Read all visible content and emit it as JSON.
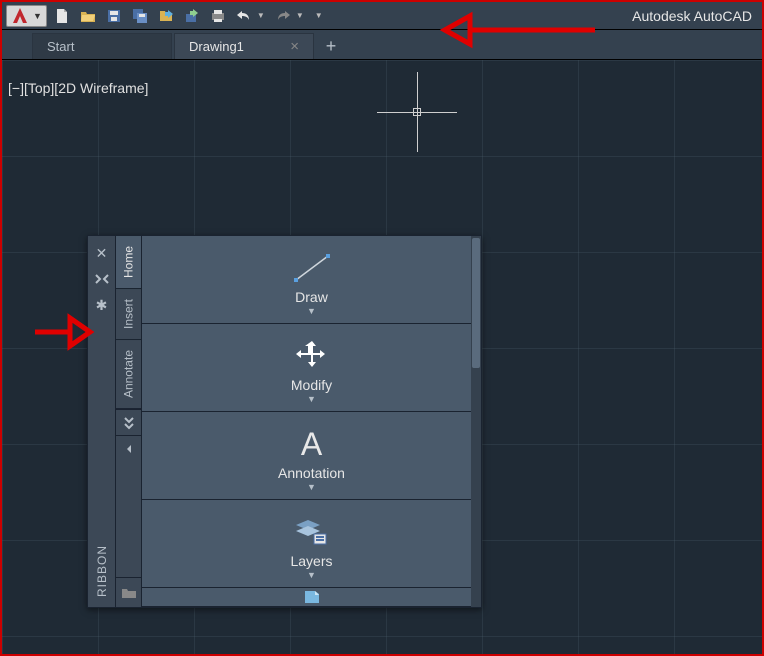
{
  "app": {
    "title": "Autodesk AutoCAD"
  },
  "qat": {
    "buttons": {
      "new": "new-file-icon",
      "open": "open-folder-icon",
      "save": "save-icon",
      "saveall": "save-all-icon",
      "web": "open-web-icon",
      "cloud": "save-cloud-icon",
      "plot": "plot-icon",
      "undo": "undo-icon",
      "redo": "redo-icon"
    }
  },
  "tabs": {
    "items": [
      {
        "label": "Start",
        "active": false,
        "closable": false
      },
      {
        "label": "Drawing1",
        "active": true,
        "closable": true
      }
    ],
    "add": "+"
  },
  "view": {
    "status": "[−][Top][2D Wireframe]"
  },
  "palette": {
    "title": "RIBBON",
    "side_buttons": {
      "close": "✕",
      "dock": "⇥",
      "settings": "✱"
    },
    "vtabs": [
      {
        "label": "Home",
        "active": true
      },
      {
        "label": "Insert",
        "active": false
      },
      {
        "label": "Annotate",
        "active": false
      }
    ],
    "icon_tabs": [
      {
        "glyph": "⇵"
      },
      {
        "glyph": "◗"
      },
      {
        "glyph": "▭"
      }
    ],
    "panels": [
      {
        "label": "Draw"
      },
      {
        "label": "Modify"
      },
      {
        "label": "Annotation"
      },
      {
        "label": "Layers"
      }
    ]
  }
}
